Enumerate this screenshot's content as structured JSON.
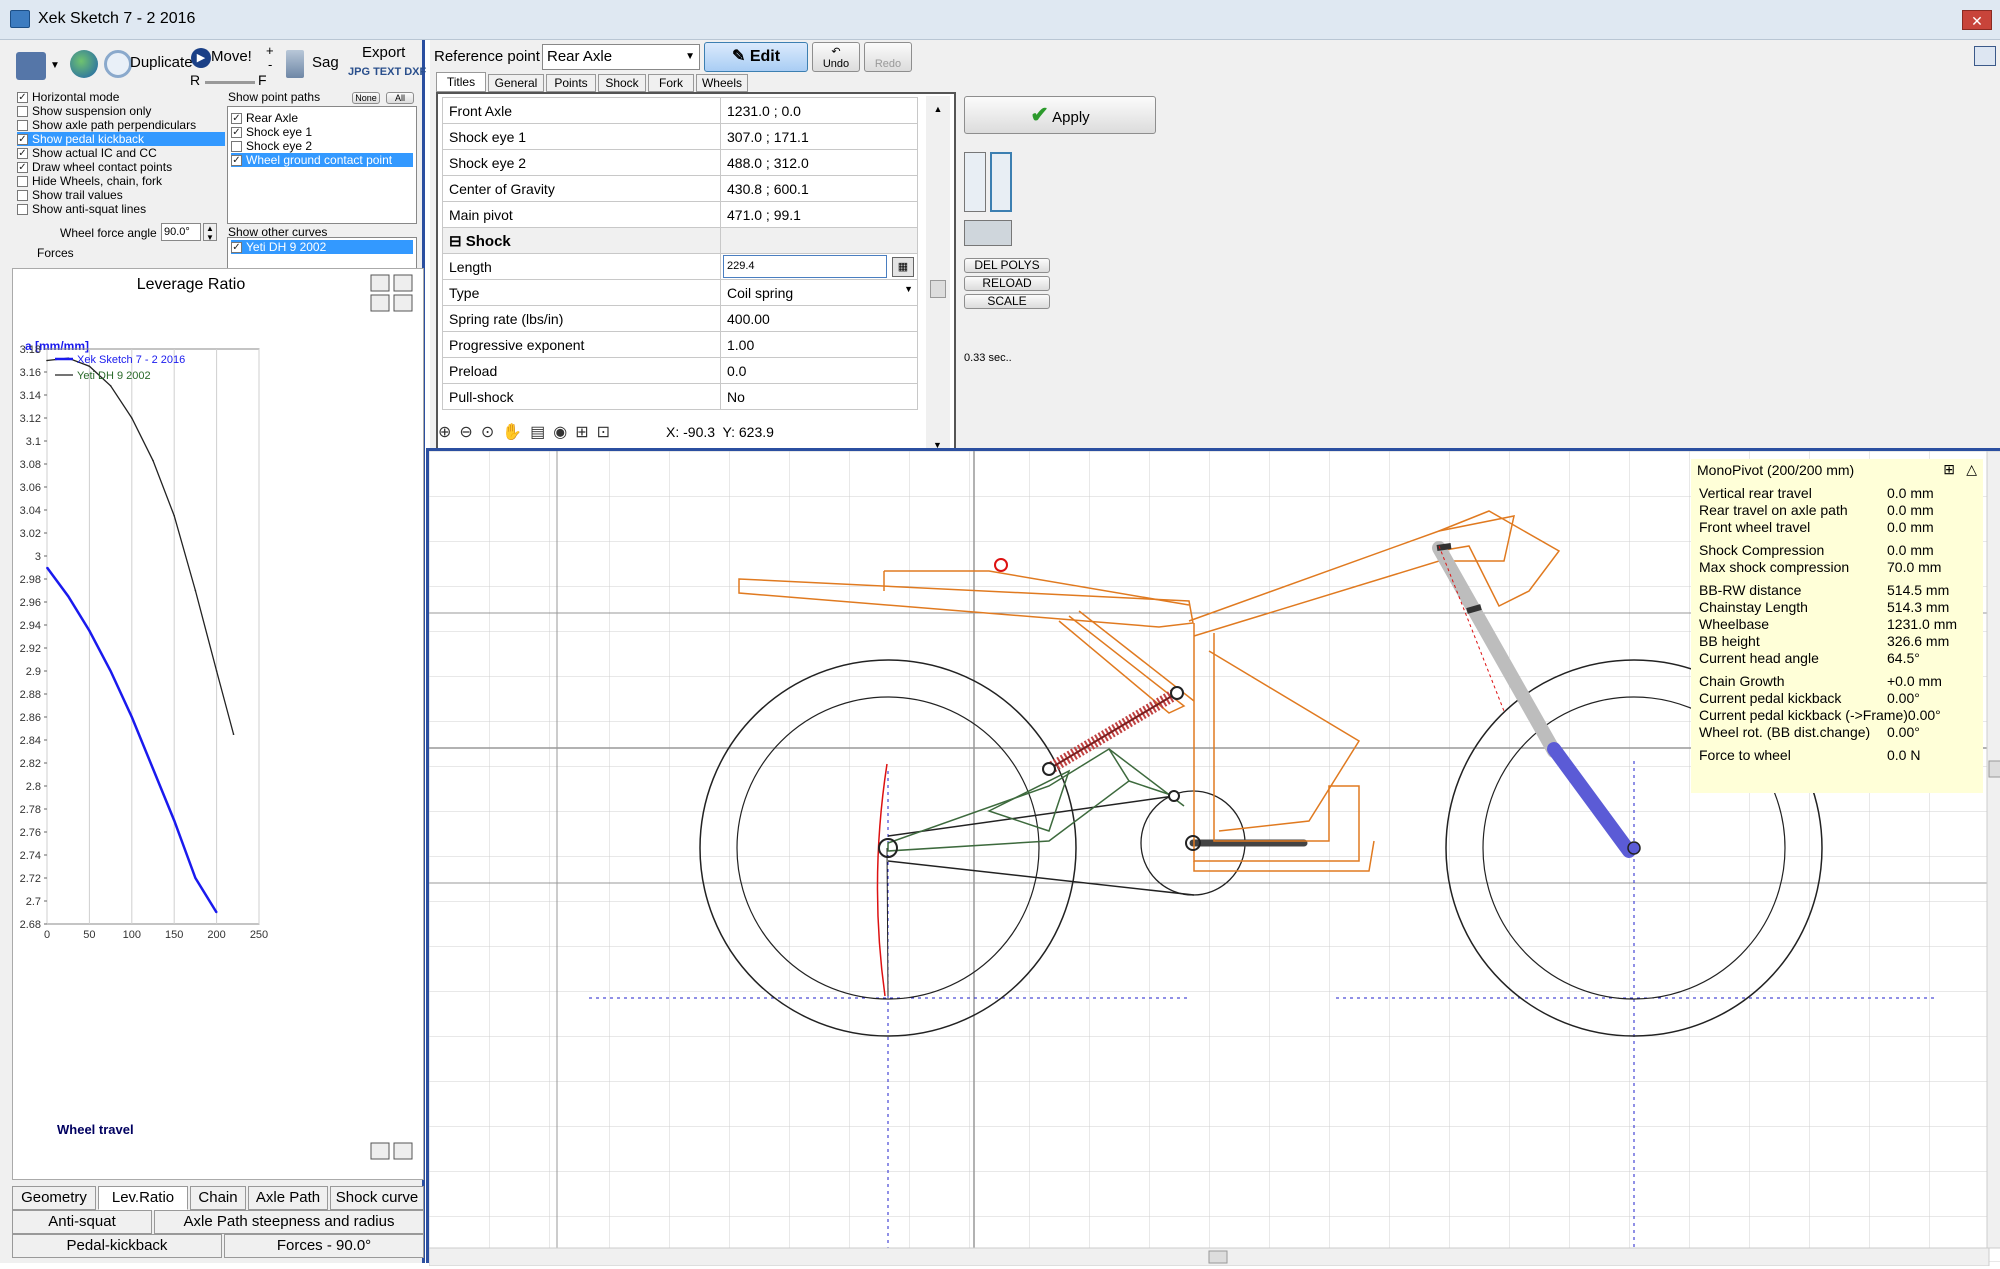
{
  "window": {
    "title": "Xek Sketch 7 - 2 2016",
    "close": "✕"
  },
  "toolbar": {
    "duplicate": "Duplicate",
    "move": "Move!",
    "move_r": "R",
    "move_f": "F",
    "sag": "Sag",
    "export": "Export",
    "export_formats": "JPG TEXT DXF",
    "plus": "+",
    "minus": "-"
  },
  "options": [
    {
      "label": "Horizontal mode",
      "checked": true,
      "selected": false
    },
    {
      "label": "Show suspension only",
      "checked": false,
      "selected": false
    },
    {
      "label": "Show axle path perpendiculars",
      "checked": false,
      "selected": false
    },
    {
      "label": "Show pedal kickback",
      "checked": true,
      "selected": true
    },
    {
      "label": "Show actual IC and CC",
      "checked": true,
      "selected": false
    },
    {
      "label": "Draw wheel contact points",
      "checked": true,
      "selected": false
    },
    {
      "label": "Hide Wheels, chain, fork",
      "checked": false,
      "selected": false
    },
    {
      "label": "Show trail values",
      "checked": false,
      "selected": false
    },
    {
      "label": "Show anti-squat lines",
      "checked": false,
      "selected": false
    }
  ],
  "wheel_force": {
    "label": "Wheel force angle",
    "value": "90.0°"
  },
  "forces_label": "Forces",
  "point_paths": {
    "title": "Show point paths",
    "none_btn": "None",
    "all_btn": "All",
    "items": [
      {
        "label": "Rear Axle",
        "checked": true,
        "selected": false
      },
      {
        "label": "Shock eye 1",
        "checked": true,
        "selected": false
      },
      {
        "label": "Shock eye 2",
        "checked": false,
        "selected": false
      },
      {
        "label": "Wheel ground contact point",
        "checked": true,
        "selected": true
      }
    ]
  },
  "other_curves": {
    "title": "Show other curves",
    "items": [
      {
        "label": "Yeti DH 9 2002",
        "checked": true,
        "selected": true
      }
    ]
  },
  "chart_data": {
    "type": "line",
    "title": "Leverage Ratio",
    "ylabel": "a [mm/mm]",
    "xlabel": "Wheel travel",
    "xlim": [
      0,
      250
    ],
    "ylim": [
      2.68,
      3.18
    ],
    "x_ticks": [
      "0",
      "50",
      "100",
      "150",
      "200",
      "250"
    ],
    "y_ticks": [
      "2.68",
      "2.7",
      "2.72",
      "2.74",
      "2.76",
      "2.78",
      "2.8",
      "2.82",
      "2.84",
      "2.86",
      "2.88",
      "2.9",
      "2.92",
      "2.94",
      "2.96",
      "2.98",
      "3",
      "3.02",
      "3.04",
      "3.06",
      "3.08",
      "3.1",
      "3.12",
      "3.14",
      "3.16",
      "3.18"
    ],
    "legend": "top-left",
    "series": [
      {
        "name": "Xek Sketch 7 - 2 2016",
        "color": "#1a1aee",
        "x": [
          0,
          25,
          50,
          75,
          100,
          125,
          150,
          175,
          200
        ],
        "y": [
          2.99,
          2.965,
          2.935,
          2.9,
          2.86,
          2.815,
          2.77,
          2.72,
          2.69
        ]
      },
      {
        "name": "Yeti DH 9 2002",
        "color": "#222222",
        "x": [
          0,
          25,
          50,
          75,
          100,
          125,
          150,
          175,
          200,
          220
        ],
        "y": [
          3.17,
          3.172,
          3.165,
          3.148,
          3.12,
          3.083,
          3.035,
          2.97,
          2.9,
          2.845
        ]
      }
    ]
  },
  "bottom_tabs": {
    "row1": [
      "Geometry",
      "Lev.Ratio",
      "Chain",
      "Axle Path",
      "Shock curve"
    ],
    "row2": [
      "Anti-squat",
      "Axle Path steepness and radius"
    ],
    "row3": [
      "Pedal-kickback",
      "Forces - 90.0°"
    ],
    "active": "Lev.Ratio"
  },
  "reference": {
    "label": "Reference point",
    "value": "Rear Axle",
    "edit": "Edit",
    "undo": "Undo",
    "redo": "Redo"
  },
  "prop_tabs": [
    "Titles",
    "General",
    "Points",
    "Shock",
    "Fork",
    "Wheels"
  ],
  "properties": [
    {
      "name": "Front Axle",
      "value": "1231.0 ; 0.0"
    },
    {
      "name": "Shock eye 1",
      "value": "307.0 ; 171.1"
    },
    {
      "name": "Shock eye 2",
      "value": "488.0 ; 312.0"
    },
    {
      "name": "Center of Gravity",
      "value": "430.8 ; 600.1"
    },
    {
      "name": "Main pivot",
      "value": "471.0 ; 99.1"
    }
  ],
  "shock_section": {
    "title": "Shock",
    "toggle": "⊟"
  },
  "shock_props": [
    {
      "name": "Length",
      "value": "229.4"
    },
    {
      "name": "Type",
      "value": "Coil spring"
    },
    {
      "name": "Spring rate (lbs/in)",
      "value": "400.00"
    },
    {
      "name": "Progressive exponent",
      "value": "1.00"
    },
    {
      "name": "Preload",
      "value": "0.0"
    },
    {
      "name": "Pull-shock",
      "value": "No"
    }
  ],
  "apply": "Apply",
  "side_buttons": {
    "del_polys": "DEL POLYS",
    "reload": "RELOAD",
    "scale": "SCALE"
  },
  "timing": "0.33 sec..",
  "coords": "X: -90.3  Y: 623.9",
  "info": {
    "title": "MonoPivot (200/200 mm)",
    "groups": [
      [
        {
          "label": "Vertical rear travel",
          "value": "0.0 mm"
        },
        {
          "label": "Rear travel on axle path",
          "value": "0.0 mm"
        },
        {
          "label": "Front wheel travel",
          "value": "0.0 mm"
        }
      ],
      [
        {
          "label": "Shock Compression",
          "value": "0.0 mm"
        },
        {
          "label": "Max shock compression",
          "value": "70.0 mm"
        }
      ],
      [
        {
          "label": "BB-RW distance",
          "value": "514.5 mm"
        },
        {
          "label": "Chainstay Length",
          "value": "514.3 mm"
        },
        {
          "label": "Wheelbase",
          "value": "1231.0 mm"
        },
        {
          "label": "BB height",
          "value": "326.6 mm"
        },
        {
          "label": "Current head angle",
          "value": "64.5°"
        }
      ],
      [
        {
          "label": "Chain Growth",
          "value": "+0.0 mm"
        },
        {
          "label": "Current pedal kickback",
          "value": "0.00°"
        },
        {
          "label": "Current pedal kickback (->Frame)",
          "value": "0.00°"
        },
        {
          "label": "Wheel rot. (BB dist.change)",
          "value": "0.00°"
        }
      ],
      [
        {
          "label": "Force to wheel",
          "value": "0.0 N"
        }
      ]
    ]
  }
}
